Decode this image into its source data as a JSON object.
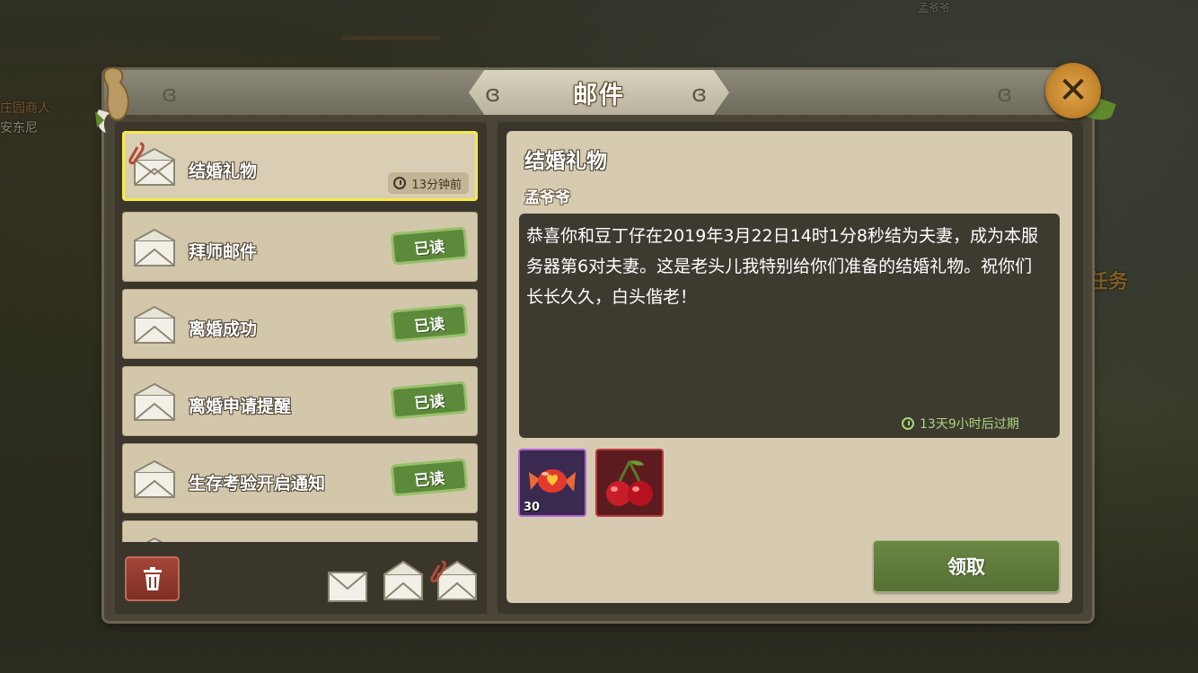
{
  "background": {
    "npc_name_1": "庄园商人",
    "npc_name_2": "安东尼",
    "npc_name_3": "孟爷爷",
    "quest_label": "任务"
  },
  "window": {
    "title": "邮件",
    "close_icon": "close-x-icon"
  },
  "mail_list": [
    {
      "title": "结婚礼物",
      "time": "13分钟前",
      "status": "",
      "selected": true,
      "has_attachment": true
    },
    {
      "title": "拜师邮件",
      "time": "",
      "status": "已读",
      "selected": false,
      "has_attachment": false
    },
    {
      "title": "离婚成功",
      "time": "",
      "status": "已读",
      "selected": false,
      "has_attachment": false
    },
    {
      "title": "离婚申请提醒",
      "time": "",
      "status": "已读",
      "selected": false,
      "has_attachment": false
    },
    {
      "title": "生存考验开启通知",
      "time": "",
      "status": "已读",
      "selected": false,
      "has_attachment": false
    }
  ],
  "detail": {
    "title": "结婚礼物",
    "sender": "孟爷爷",
    "body": "恭喜你和豆丁仔在2019年3月22日14时1分8秒结为夫妻，成为本服务器第6对夫妻。这是老头儿我特别给你们准备的结婚礼物。祝你们长长久久，白头偕老！",
    "expire": "13天9小时后过期",
    "attachments": [
      {
        "icon": "candy-icon",
        "quantity": "30",
        "rarity_color": "#b263d4"
      },
      {
        "icon": "cherry-icon",
        "quantity": "",
        "rarity_color": "#b63b3e"
      }
    ],
    "claim_label": "领取"
  },
  "colors": {
    "selected_border": "#f6e94a",
    "read_badge": "#5d8a3a",
    "claim_button": "#6b8744",
    "delete_button": "#a7473a"
  }
}
